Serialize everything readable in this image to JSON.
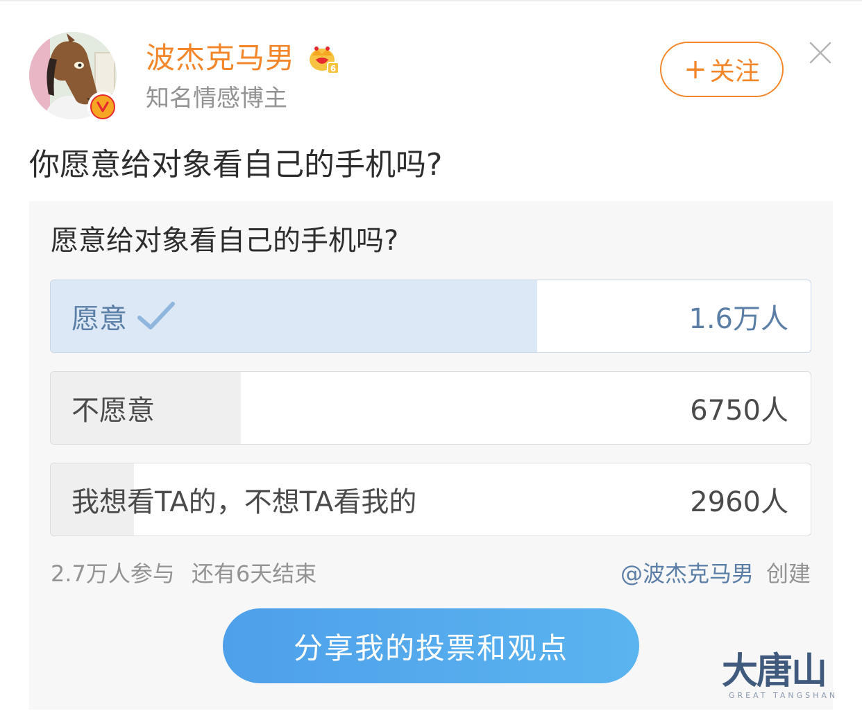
{
  "header": {
    "username": "波杰克马男",
    "subtitle": "知名情感博主",
    "follow_label": "关注"
  },
  "post": {
    "text": "你愿意给对象看自己的手机吗?"
  },
  "poll": {
    "question": "愿意给对象看自己的手机吗?",
    "options": [
      {
        "label": "愿意",
        "count": "1.6万人",
        "share": 0.64,
        "selected": true
      },
      {
        "label": "不愿意",
        "count": "6750人",
        "share": 0.25,
        "selected": false
      },
      {
        "label": "我想看TA的，不想TA看我的",
        "count": "2960人",
        "share": 0.11,
        "selected": false
      }
    ],
    "participants": "2.7万人参与",
    "remaining": "还有6天结束",
    "creator": "@波杰克马男",
    "created_label": "创建",
    "share_button": "分享我的投票和观点"
  },
  "watermark": {
    "main": "大唐山",
    "sub": "GREAT TANGSHAN"
  },
  "colors": {
    "accent_orange": "#f3862b",
    "link_blue": "#5b7ea6",
    "button_blue": "#4ea0ea",
    "selected_fill": "#dce8f5"
  },
  "icons": {
    "avatar": "horse-avatar",
    "verified": "verified-v-icon",
    "member": "crown-icon",
    "close": "close-icon",
    "check": "check-icon"
  }
}
